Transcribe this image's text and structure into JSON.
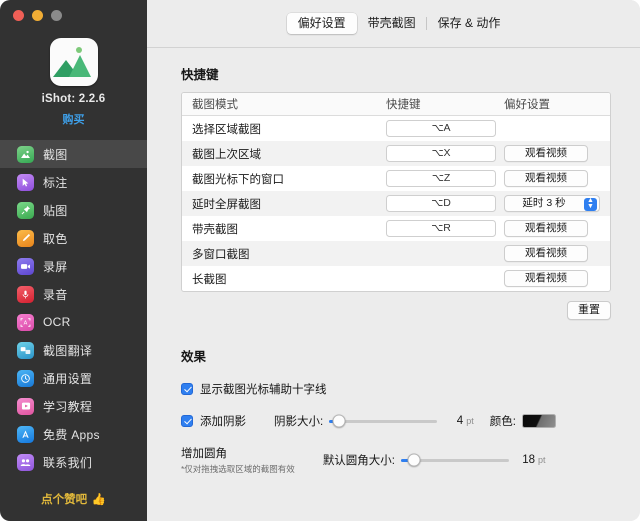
{
  "window": {
    "traffic_lights": [
      "close",
      "minimize",
      "zoom"
    ]
  },
  "sidebar": {
    "app_name_version": "iShot: 2.2.6",
    "buy_label": "购买",
    "items": [
      {
        "label": "截图",
        "icon": "screenshot-icon",
        "active": true
      },
      {
        "label": "标注",
        "icon": "annotate-icon",
        "active": false
      },
      {
        "label": "贴图",
        "icon": "pin-image-icon",
        "active": false
      },
      {
        "label": "取色",
        "icon": "color-picker-icon",
        "active": false
      },
      {
        "label": "录屏",
        "icon": "screen-record-icon",
        "active": false
      },
      {
        "label": "录音",
        "icon": "audio-record-icon",
        "active": false
      },
      {
        "label": "OCR",
        "icon": "ocr-icon",
        "active": false
      },
      {
        "label": "截图翻译",
        "icon": "translate-icon",
        "active": false
      },
      {
        "label": "通用设置",
        "icon": "general-settings-icon",
        "active": false
      },
      {
        "label": "学习教程",
        "icon": "tutorial-icon",
        "active": false
      },
      {
        "label": "免费 Apps",
        "icon": "free-apps-icon",
        "active": false
      },
      {
        "label": "联系我们",
        "icon": "contact-us-icon",
        "active": false
      }
    ],
    "footer": {
      "label": "点个赞吧",
      "icon": "thumbs-up-icon",
      "emoji": "👍"
    }
  },
  "tabs": [
    {
      "label": "偏好设置",
      "selected": true
    },
    {
      "label": "带壳截图",
      "selected": false
    },
    {
      "label": "保存 & 动作",
      "selected": false
    }
  ],
  "shortcuts_section": {
    "title": "快捷键",
    "columns": [
      "截图模式",
      "快捷键",
      "偏好设置"
    ],
    "rows": [
      {
        "mode": "选择区域截图",
        "key": "⌥A",
        "pref_type": "none",
        "pref_label": ""
      },
      {
        "mode": "截图上次区域",
        "key": "⌥X",
        "pref_type": "button",
        "pref_label": "观看视频"
      },
      {
        "mode": "截图光标下的窗口",
        "key": "⌥Z",
        "pref_type": "button",
        "pref_label": "观看视频"
      },
      {
        "mode": "延时全屏截图",
        "key": "⌥D",
        "pref_type": "popup",
        "pref_label": "延时 3 秒"
      },
      {
        "mode": "带壳截图",
        "key": "⌥R",
        "pref_type": "button",
        "pref_label": "观看视频"
      },
      {
        "mode": "多窗口截图",
        "key": "",
        "pref_type": "button",
        "pref_label": "观看视频"
      },
      {
        "mode": "长截图",
        "key": "",
        "pref_type": "button",
        "pref_label": "观看视频"
      }
    ],
    "reset_label": "重置"
  },
  "effects_section": {
    "title": "效果",
    "crosshair": {
      "label": "显示截图光标辅助十字线",
      "checked": true
    },
    "shadow": {
      "label": "添加阴影",
      "checked": true,
      "slider_label": "阴影大小:",
      "value": "4",
      "unit": "pt",
      "percent": 9,
      "color_label": "颜色:",
      "color_value": "#101010"
    },
    "corner": {
      "label": "增加圆角",
      "checked": false,
      "slider_label": "默认圆角大小:",
      "value": "18",
      "unit": "pt",
      "percent": 12,
      "note": "*仅对拖拽选取区域的截图有效"
    }
  },
  "colors": {
    "accent": "#2f7ff0",
    "sidebar_bg": "#323232",
    "main_bg": "#ececec",
    "link": "#3e9fe8",
    "footer_text": "#e2b93b"
  }
}
